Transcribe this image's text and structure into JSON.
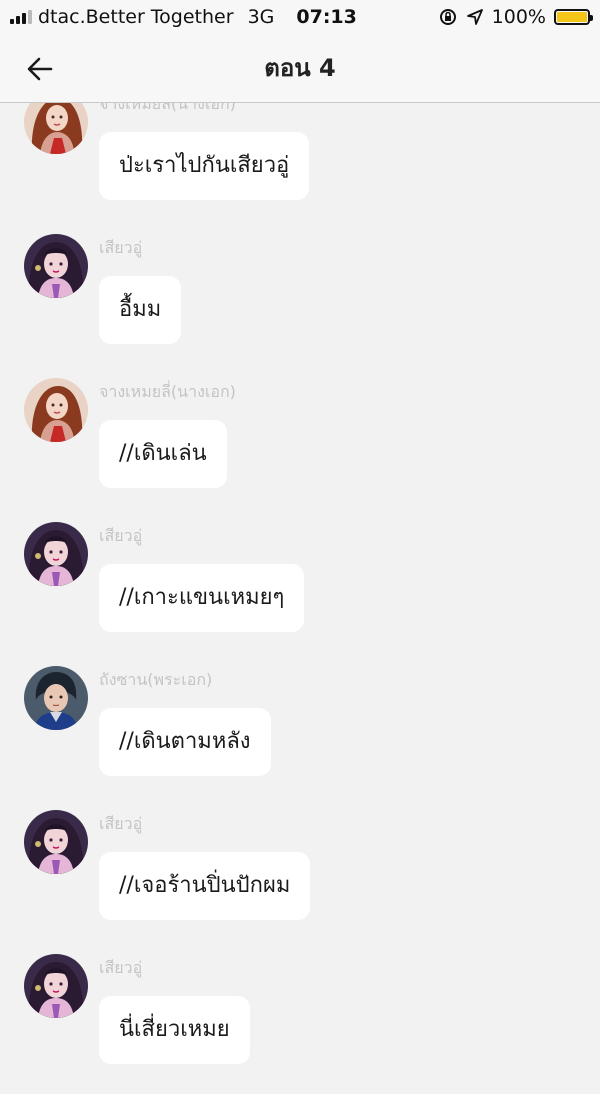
{
  "status_bar": {
    "carrier": "dtac.Better Together",
    "network": "3G",
    "time": "07:13",
    "battery_percent": "100%",
    "battery_level": 1.0
  },
  "header": {
    "title": "ตอน 4",
    "back_icon": "arrow-left-icon"
  },
  "messages": [
    {
      "sender": "จางเหมยลี่(นางเอก)",
      "avatar": "heroine",
      "text": "ป่ะเราไปกันเสียวอู่"
    },
    {
      "sender": "เสียวอู่",
      "avatar": "xiaowu",
      "text": "อื้มม"
    },
    {
      "sender": "จางเหมยลี่(นางเอก)",
      "avatar": "heroine",
      "text": "//เดินเล่น"
    },
    {
      "sender": "เสียวอู่",
      "avatar": "xiaowu",
      "text": "//เกาะแขนเหมยๆ"
    },
    {
      "sender": "ถังซาน(พระเอก)",
      "avatar": "hero",
      "text": "//เดินตามหลัง"
    },
    {
      "sender": "เสียวอู่",
      "avatar": "xiaowu",
      "text": "//เจอร้านปิ่นปักผม"
    },
    {
      "sender": "เสียวอู่",
      "avatar": "xiaowu",
      "text": "นี่เสี่ยวเหมย"
    }
  ],
  "colors": {
    "background": "#f2f2f2",
    "bubble": "#ffffff",
    "sender_text": "#c4c4c4",
    "battery": "#f5c518"
  }
}
